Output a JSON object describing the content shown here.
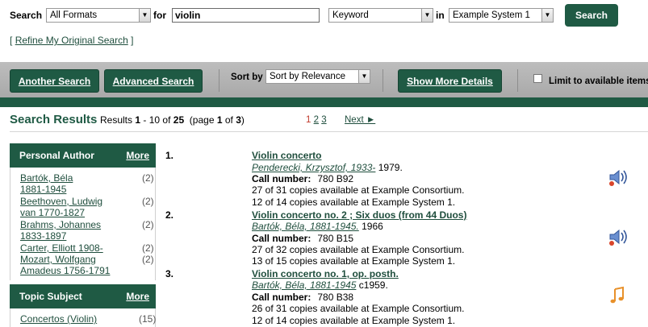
{
  "search": {
    "search_label": "Search",
    "format_value": "All Formats",
    "for_label": "for",
    "query_value": "violin",
    "field_value": "Keyword",
    "in_label": "in",
    "system_value": "Example System 1",
    "search_button": "Search",
    "refine_prefix": "[",
    "refine_link": "Refine My Original Search",
    "refine_suffix": "]"
  },
  "toolbar": {
    "another_search": "Another Search",
    "advanced_search": "Advanced Search",
    "sort_by_label": "Sort by",
    "sort_value": "Sort by Relevance",
    "show_more_details": "Show More Details",
    "limit_label": "Limit to available items"
  },
  "results_header": {
    "title": "Search Results",
    "summary_prefix": "Results",
    "range_start": "1",
    "range_sep": "- 10 of",
    "total": "25",
    "page_text": "(page",
    "page_current": "1",
    "page_of": "of",
    "page_total": "3",
    "page_close": ")",
    "pages": [
      "1",
      "2",
      "3"
    ],
    "next": "Next ►"
  },
  "facets": {
    "author_title": "Personal Author",
    "author_more": "More",
    "authors": [
      {
        "line1": "Bartók, Béla",
        "line2": "1881-1945",
        "count": "(2)"
      },
      {
        "line1": "Beethoven, Ludwig",
        "line2": "van 1770-1827",
        "count": "(2)"
      },
      {
        "line1": "Brahms, Johannes",
        "line2": "1833-1897",
        "count": "(2)"
      },
      {
        "line1": "Carter, Elliott 1908-",
        "line2": "",
        "count": "(2)"
      },
      {
        "line1": "Mozart, Wolfgang",
        "line2": "Amadeus 1756-1791",
        "count": "(2)"
      }
    ],
    "topic_title": "Topic Subject",
    "topic_more": "More",
    "topics": [
      {
        "label": "Concertos (Violin)",
        "count": "(15)"
      }
    ]
  },
  "results": [
    {
      "num": "1.",
      "title": "Violin concerto",
      "author": "Penderecki, Krzysztof, 1933-",
      "year": "1979.",
      "call_label": "Call number:",
      "call_value": "780 B92",
      "avail1": "27 of 31 copies available at Example Consortium.",
      "avail2": "12 of 14 copies available at Example System 1.",
      "icon": "audio-speaker-icon"
    },
    {
      "num": "2.",
      "title": "Violin concerto no. 2 ; Six duos (from 44 Duos)",
      "author": "Bartók, Béla, 1881-1945.",
      "year": "1966",
      "call_label": "Call number:",
      "call_value": "780 B15",
      "avail1": "27 of 32 copies available at Example Consortium.",
      "avail2": "13 of 15 copies available at Example System 1.",
      "icon": "audio-speaker-icon"
    },
    {
      "num": "3.",
      "title": "Violin concerto no. 1, op. posth.",
      "author": "Bartók, Béla, 1881-1945",
      "year": "c1959.",
      "call_label": "Call number:",
      "call_value": "780 B38",
      "avail1": "26 of 31 copies available at Example Consortium.",
      "avail2": "12 of 14 copies available at Example System 1.",
      "icon": "music-note-icon"
    }
  ]
}
